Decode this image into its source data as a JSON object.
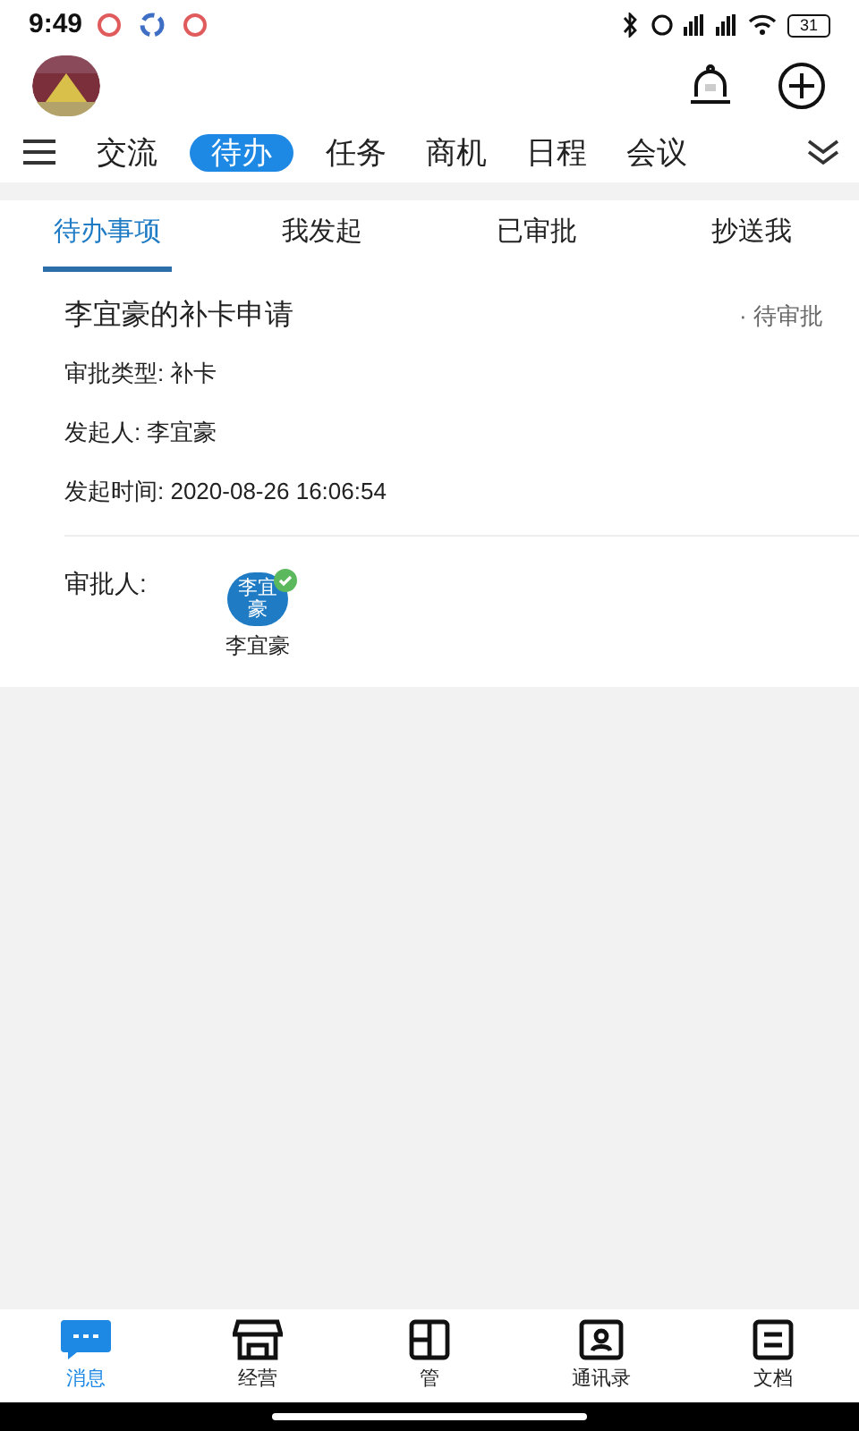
{
  "status_bar": {
    "time": "9:49",
    "battery": "31"
  },
  "channels": [
    {
      "label": "交流",
      "selected": false
    },
    {
      "label": "待办",
      "selected": true
    },
    {
      "label": "任务",
      "selected": false
    },
    {
      "label": "商机",
      "selected": false
    },
    {
      "label": "日程",
      "selected": false
    },
    {
      "label": "会议",
      "selected": false
    }
  ],
  "sub_tabs": [
    {
      "label": "待办事项",
      "selected": true
    },
    {
      "label": "我发起",
      "selected": false
    },
    {
      "label": "已审批",
      "selected": false
    },
    {
      "label": "抄送我",
      "selected": false
    }
  ],
  "request": {
    "title": "李宜豪的补卡申请",
    "status": "· 待审批",
    "fields": [
      "审批类型: 补卡",
      "发起人: 李宜豪",
      "发起时间: 2020-08-26 16:06:54"
    ],
    "approver_label": "审批人:",
    "approver": {
      "avatar_text": "李宜豪",
      "name": "李宜豪",
      "approved": true
    }
  },
  "bottom_nav": [
    {
      "label": "消息",
      "kind": "chat",
      "selected": true
    },
    {
      "label": "经营",
      "kind": "store",
      "selected": false
    },
    {
      "label": "管",
      "kind": "doc",
      "selected": false
    },
    {
      "label": "通讯录",
      "kind": "contacts",
      "selected": false
    },
    {
      "label": "文档",
      "kind": "files",
      "selected": false
    }
  ]
}
